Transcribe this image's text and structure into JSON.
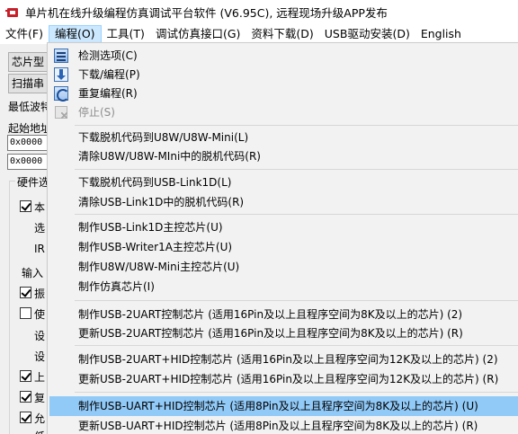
{
  "window": {
    "title": "单片机在线升级编程仿真调试平台软件 (V6.95C), 远程现场升级APP发布"
  },
  "menubar": {
    "items": [
      {
        "label": "文件(F)"
      },
      {
        "label": "编程(O)",
        "active": true
      },
      {
        "label": "工具(T)"
      },
      {
        "label": "调试仿真接口(G)"
      },
      {
        "label": "资料下载(D)"
      },
      {
        "label": "USB驱动安装(D)"
      },
      {
        "label": "English"
      }
    ]
  },
  "left_panel": {
    "chip_button": "芯片型",
    "scan_button": "扫描串",
    "lowest_baud_label": "最低波特",
    "start_addr_label": "起始地址",
    "start_addr_value": "0x0000",
    "end_addr_value": "0x0000",
    "hw_group_title": "硬件选",
    "hw_items": [
      {
        "label": "本",
        "checkbox": true,
        "checked": true
      },
      {
        "label": "选",
        "checkbox": false
      },
      {
        "label": "IR",
        "checkbox": false
      },
      {
        "label": "输入",
        "checkbox": false
      },
      {
        "label": "振",
        "checkbox": true,
        "checked": true
      },
      {
        "label": "使",
        "checkbox": true,
        "checked": false
      },
      {
        "label": "设",
        "checkbox": false
      },
      {
        "label": "设",
        "checkbox": false
      },
      {
        "label": "上",
        "checkbox": true,
        "checked": true
      },
      {
        "label": "复",
        "checkbox": true,
        "checked": true
      },
      {
        "label": "允",
        "checkbox": true,
        "checked": true
      },
      {
        "label": "低",
        "checkbox": false
      }
    ]
  },
  "dropdown": {
    "items": [
      {
        "label": "检测选项(C)",
        "icon": "detect-options-icon"
      },
      {
        "label": "下载/编程(P)",
        "icon": "download-program-icon"
      },
      {
        "label": "重复编程(R)",
        "icon": "repeat-program-icon"
      },
      {
        "label": "停止(S)",
        "icon": "stop-icon",
        "disabled": true
      },
      {
        "label": "下载脱机代码到U8W/U8W-Mini(L)"
      },
      {
        "label": "清除U8W/U8W-MIni中的脱机代码(R)"
      },
      {
        "label": "下载脱机代码到USB-Link1D(L)"
      },
      {
        "label": "清除USB-Link1D中的脱机代码(R)"
      },
      {
        "label": "制作USB-Link1D主控芯片(U)"
      },
      {
        "label": "制作USB-Writer1A主控芯片(U)"
      },
      {
        "label": "制作U8W/U8W-Mini主控芯片(U)"
      },
      {
        "label": "制作仿真芯片(I)"
      },
      {
        "label": "制作USB-2UART控制芯片 (适用16Pin及以上且程序空间为8K及以上的芯片) (2)"
      },
      {
        "label": "更新USB-2UART控制芯片 (适用16Pin及以上且程序空间为8K及以上的芯片) (R)"
      },
      {
        "label": "制作USB-2UART+HID控制芯片 (适用16Pin及以上且程序空间为12K及以上的芯片) (2)"
      },
      {
        "label": "更新USB-2UART+HID控制芯片 (适用16Pin及以上且程序空间为12K及以上的芯片) (R)"
      },
      {
        "label": "制作USB-UART+HID控制芯片 (适用8Pin及以上且程序空间为8K及以上的芯片) (U)",
        "highlight": true
      },
      {
        "label": "更新USB-UART+HID控制芯片 (适用8Pin及以上且程序空间为8K及以上的芯片) (R)"
      }
    ]
  },
  "colors": {
    "menu_active_bg": "#cce8ff",
    "dropdown_bg": "#f2f2f2",
    "highlight_bg": "#91c9f7",
    "disabled_text": "#8d8d8d"
  }
}
